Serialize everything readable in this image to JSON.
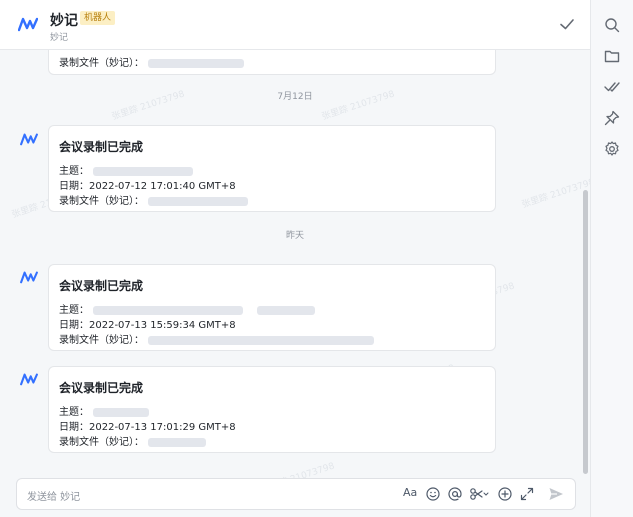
{
  "header": {
    "title": "妙记",
    "badge": "机器人",
    "subtitle": "妙记",
    "icons": {
      "logo": "miaoji-logo-icon",
      "done": "check-icon"
    }
  },
  "rail": {
    "icons": [
      "search-icon",
      "folder-icon",
      "double-check-icon",
      "pin-icon",
      "gear-icon"
    ]
  },
  "chat": {
    "top_partial": {
      "file_label": "录制文件（妙记）："
    },
    "separators": [
      "7月12日",
      "昨天"
    ],
    "messages": [
      {
        "title": "会议录制已完成",
        "topic_label": "主题：",
        "date_label": "日期：",
        "date_value": "2022-07-12 17:01:40 GMT+8",
        "file_label": "录制文件（妙记）："
      },
      {
        "title": "会议录制已完成",
        "topic_label": "主题：",
        "date_label": "日期：",
        "date_value": "2022-07-13 15:59:34 GMT+8",
        "file_label": "录制文件（妙记）："
      },
      {
        "title": "会议录制已完成",
        "topic_label": "主题：",
        "date_label": "日期：",
        "date_value": "2022-07-13 17:01:29 GMT+8",
        "file_label": "录制文件（妙记）："
      }
    ]
  },
  "input": {
    "placeholder": "发送给 妙记",
    "font_button": "Aa",
    "icons": [
      "emoji-icon",
      "mention-icon",
      "scissors-icon",
      "plus-circle-icon",
      "expand-icon",
      "send-icon"
    ]
  },
  "watermark": "张里踪 21073798",
  "colors": {
    "brand": "#3370ff",
    "badge_bg": "#fcefc4",
    "badge_text": "#b7800f"
  }
}
